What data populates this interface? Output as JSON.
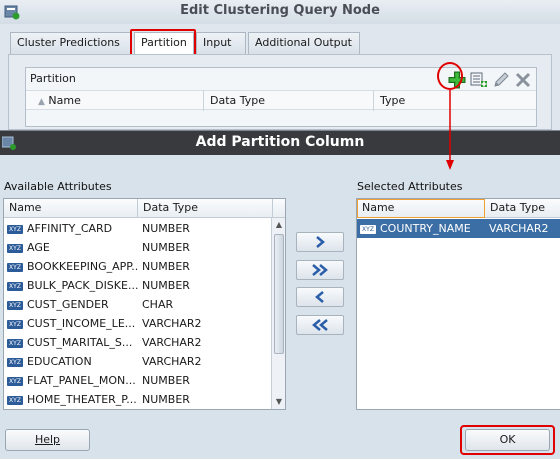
{
  "background_dialog": {
    "title": "Edit Clustering Query Node",
    "tabs": [
      "Cluster Predictions",
      "Partition",
      "Input",
      "Additional Output"
    ],
    "active_tab": "Partition",
    "partition_label": "Partition",
    "columns": [
      "Name",
      "Data Type",
      "Type"
    ],
    "toolbar_icons": [
      "add-icon",
      "edit-multi-icon",
      "pencil-icon",
      "delete-icon"
    ]
  },
  "dialog": {
    "title": "Add Partition Column",
    "available_label": "Available Attributes",
    "selected_label": "Selected Attributes",
    "available_columns": [
      "Name",
      "Data Type"
    ],
    "selected_columns": [
      "Name",
      "Data Type"
    ],
    "available_rows": [
      {
        "name": "AFFINITY_CARD",
        "type": "NUMBER"
      },
      {
        "name": "AGE",
        "type": "NUMBER"
      },
      {
        "name": "BOOKKEEPING_APP...",
        "type": "NUMBER"
      },
      {
        "name": "BULK_PACK_DISKE...",
        "type": "NUMBER"
      },
      {
        "name": "CUST_GENDER",
        "type": "CHAR"
      },
      {
        "name": "CUST_INCOME_LE...",
        "type": "VARCHAR2"
      },
      {
        "name": "CUST_MARITAL_S...",
        "type": "VARCHAR2"
      },
      {
        "name": "EDUCATION",
        "type": "VARCHAR2"
      },
      {
        "name": "FLAT_PANEL_MON...",
        "type": "NUMBER"
      },
      {
        "name": "HOME_THEATER_P...",
        "type": "NUMBER"
      }
    ],
    "selected_rows": [
      {
        "name": "COUNTRY_NAME",
        "type": "VARCHAR2"
      }
    ],
    "move_buttons": [
      ">",
      ">>",
      "<",
      "<<"
    ],
    "help_label": "Help",
    "ok_label": "OK",
    "icon_badge": "XYZ"
  },
  "colors": {
    "title_bar_dark": "#383a3d",
    "selection": "#3a6ea5",
    "highlight_red": "#e00000",
    "add_green": "#2e9b2e"
  }
}
